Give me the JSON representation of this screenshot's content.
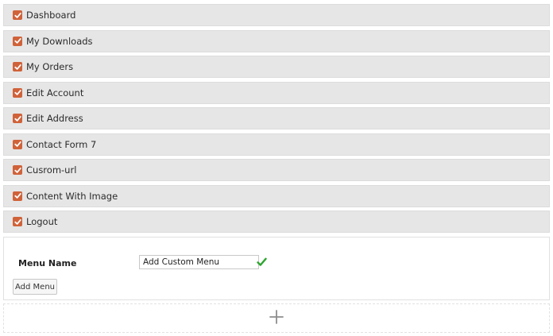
{
  "menu_items": [
    {
      "label": "Dashboard",
      "checked": true
    },
    {
      "label": "My Downloads",
      "checked": true
    },
    {
      "label": "My Orders",
      "checked": true
    },
    {
      "label": "Edit Account",
      "checked": true
    },
    {
      "label": "Edit Address",
      "checked": true
    },
    {
      "label": "Contact Form 7",
      "checked": true
    },
    {
      "label": "Cusrom-url",
      "checked": true
    },
    {
      "label": "Content With Image",
      "checked": true
    },
    {
      "label": "Logout",
      "checked": true
    }
  ],
  "form": {
    "menu_name_label": "Menu Name",
    "menu_name_value": "Add Custom Menu",
    "add_button_label": "Add Menu"
  },
  "icons": {
    "checkbox": "checkbox-checked-icon",
    "valid": "checkmark-icon",
    "add": "plus-icon"
  },
  "colors": {
    "checkbox": "#d0623a",
    "valid_check": "#2fa52f",
    "item_background": "#e6e6e6"
  }
}
